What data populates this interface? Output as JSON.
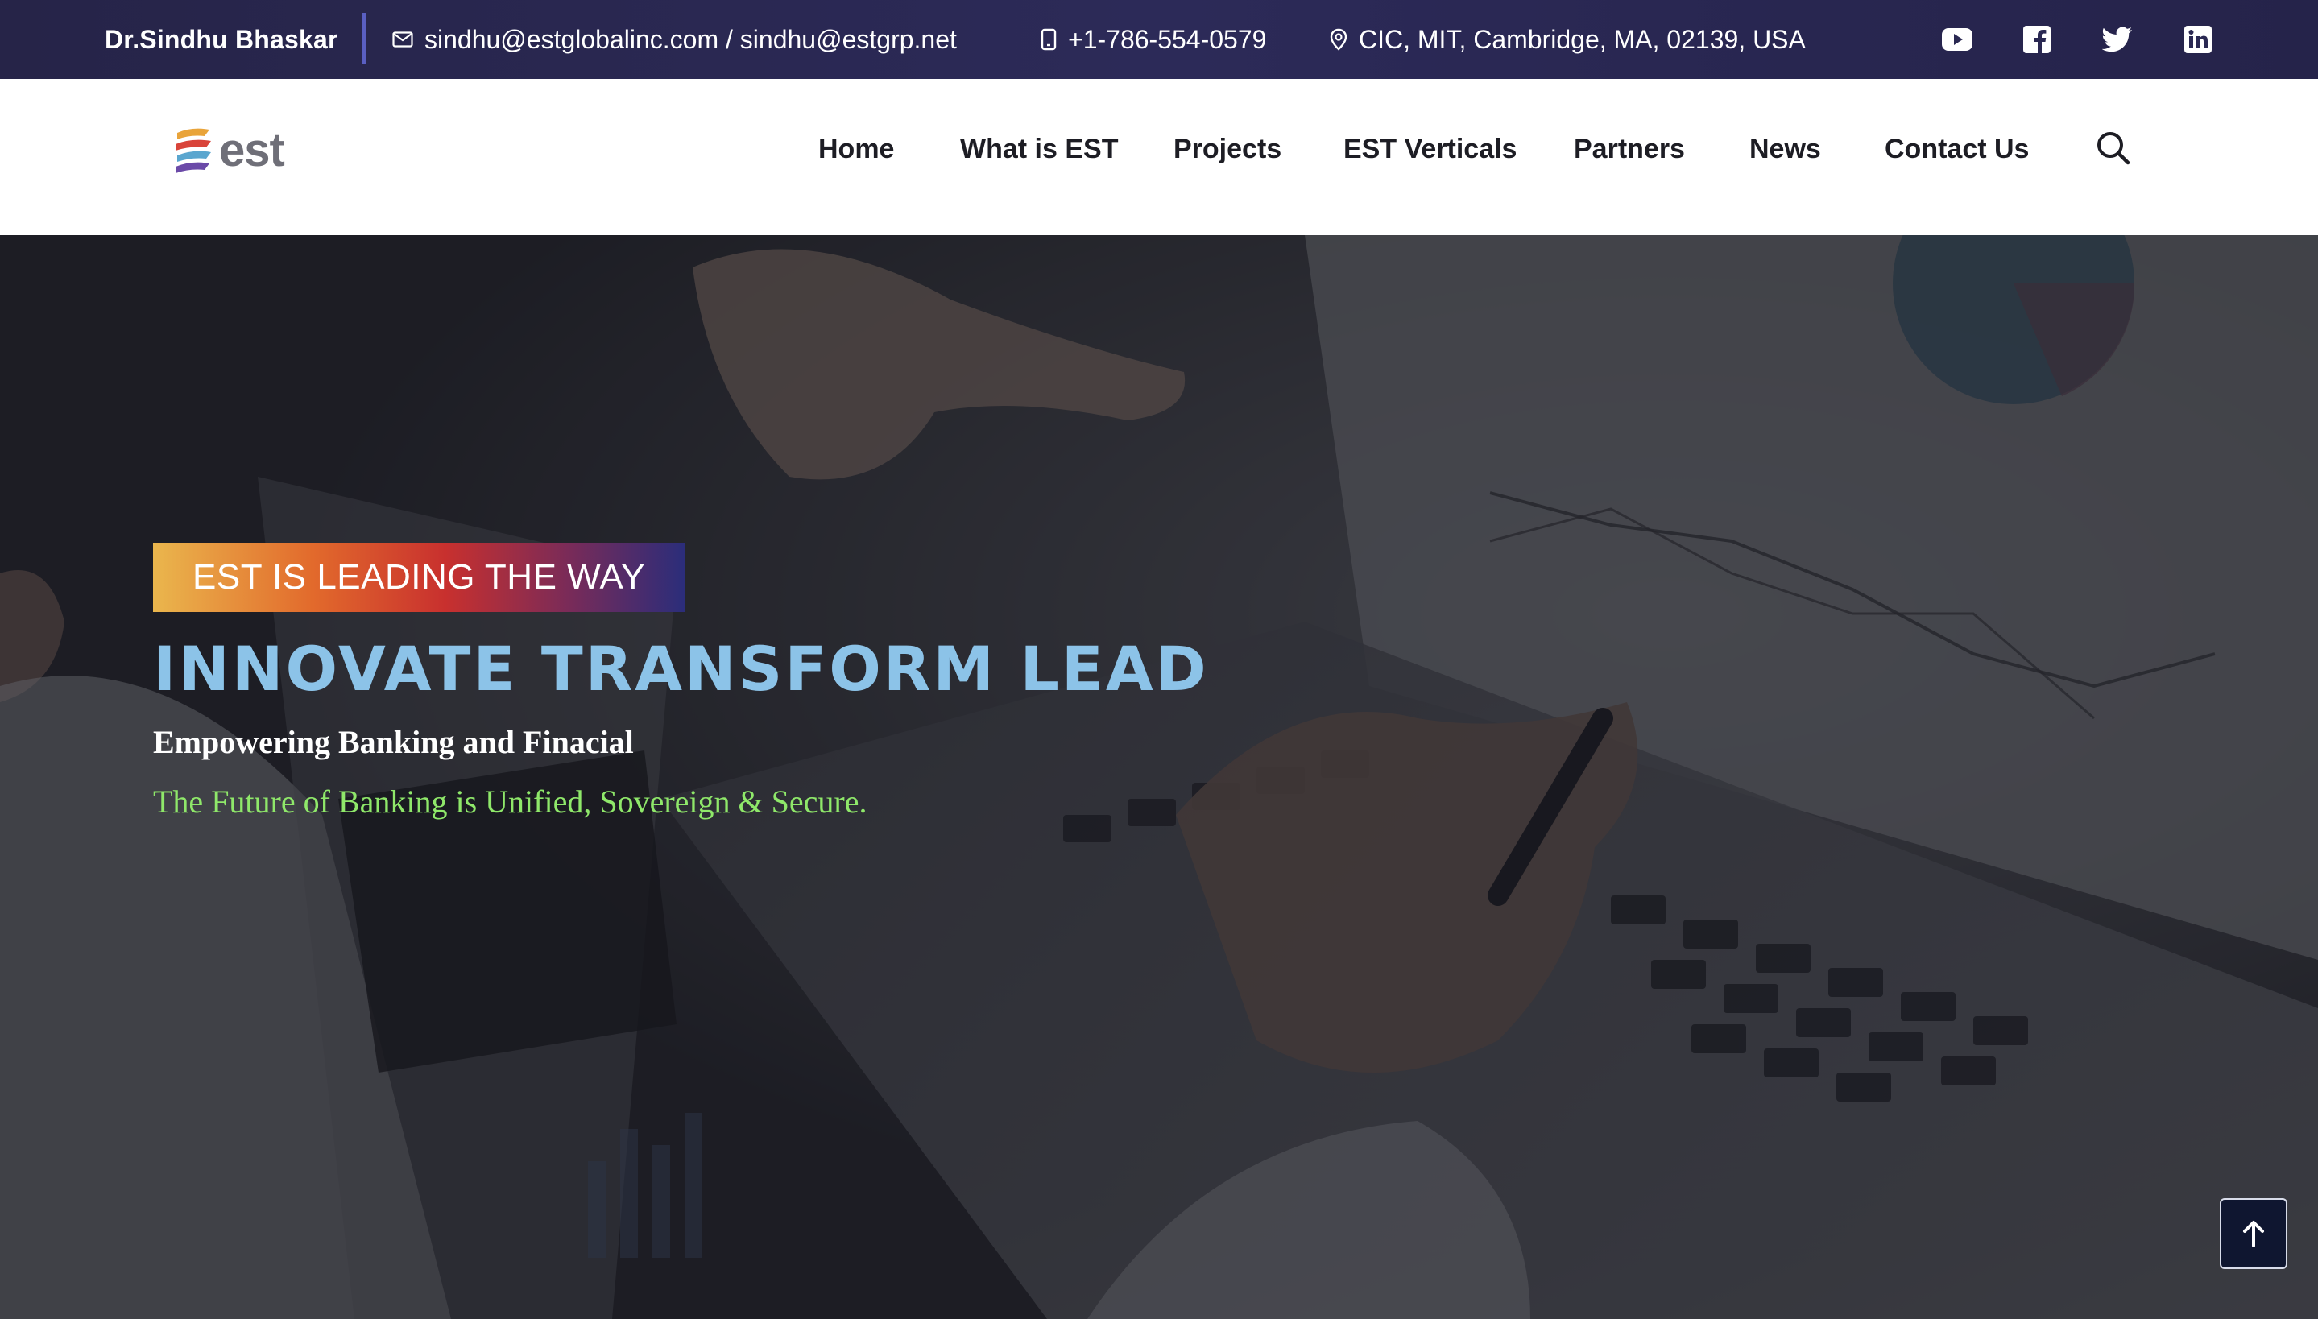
{
  "topbar": {
    "name": "Dr.Sindhu Bhaskar",
    "email": "sindhu@estglobalinc.com / sindhu@estgrp.net",
    "phone": "+1-786-554-0579",
    "address": "CIC, MIT, Cambridge, MA, 02139, USA",
    "email_icon": "mail-icon",
    "phone_icon": "mobile-phone-icon",
    "address_icon": "map-pin-icon",
    "social": [
      "youtube-icon",
      "facebook-icon",
      "twitter-icon",
      "linkedin-icon"
    ]
  },
  "nav": {
    "logo_text": "est",
    "items": [
      "Home",
      "What is EST",
      "Projects",
      "EST Verticals",
      "Partners",
      "News",
      "Contact Us"
    ],
    "search_icon": "search-icon"
  },
  "hero": {
    "badge": "EST IS LEADING THE WAY",
    "headline": "INNOVATE TRANSFORM LEAD",
    "subtitle": "Empowering Banking and Finacial",
    "tagline": "The Future of Banking is Unified, Sovereign & Secure.",
    "scroll_top_icon": "arrow-up-icon"
  },
  "colors": {
    "topbar_bg": "#2a2852",
    "headline": "#8cc3e8",
    "tagline": "#8fe86a",
    "nav_text": "#1d1d24"
  }
}
